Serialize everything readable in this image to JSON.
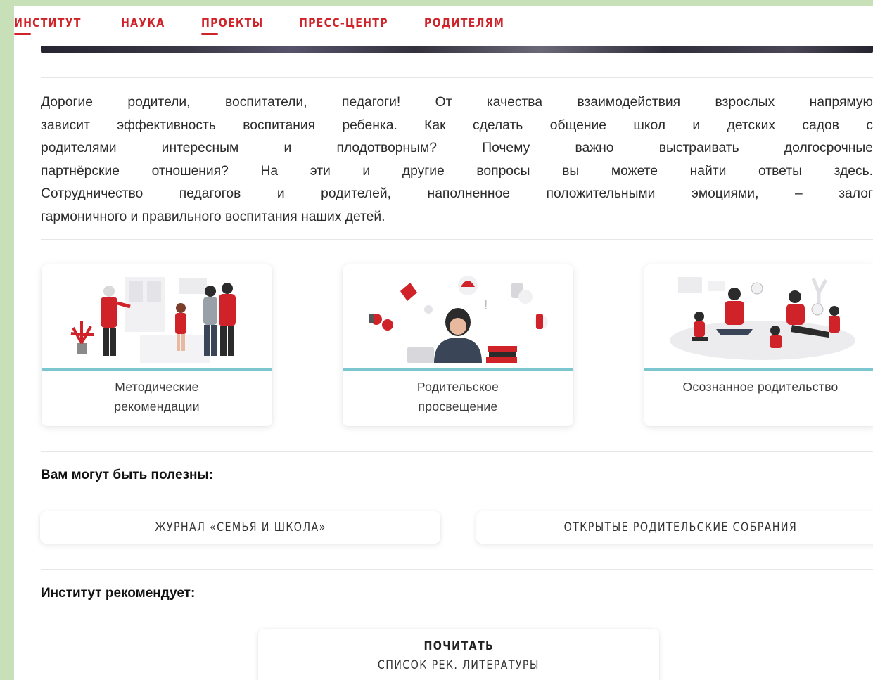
{
  "nav": {
    "items": [
      {
        "label": "ИНСТИТУТ",
        "active": true
      },
      {
        "label": "НАУКА",
        "active": false
      },
      {
        "label": "ПРОЕКТЫ",
        "active": true
      },
      {
        "label": "ПРЕСС-ЦЕНТР",
        "active": false
      },
      {
        "label": "РОДИТЕЛЯМ",
        "active": false
      }
    ]
  },
  "intro": {
    "lines": [
      "Дорогие родители, воспитатели, педагоги! От качества взаимодействия взрослых напрямую",
      "зависит эффективность воспитания ребенка. Как сделать общение школ и детских садов с",
      "родителями интересным и плодотворным? Почему важно выстраивать долгосрочные",
      "партнёрские отношения? На эти и другие вопросы вы можете найти ответы здесь.",
      "Сотрудничество педагогов и родителей, наполненное положительными эмоциями, – залог",
      "гармоничного и правильного воспитания наших детей."
    ]
  },
  "cards": [
    {
      "line1": "Методические",
      "line2": "рекомендации",
      "icon": "family-with-teacher-illustration"
    },
    {
      "line1": "Родительское",
      "line2": "просвещение",
      "icon": "thinking-parent-illustration"
    },
    {
      "line1": "Осознанное родительство",
      "line2": "",
      "icon": "family-playing-illustration"
    }
  ],
  "useful": {
    "title": "Вам могут быть полезны:",
    "buttons": [
      "ЖУРНАЛ «СЕМЬЯ И ШКОЛА»",
      "ОТКРЫТЫЕ РОДИТЕЛЬСКИЕ СОБРАНИЯ"
    ]
  },
  "recommends": {
    "title": "Институт рекомендует:",
    "button_line1": "ПОЧИТАТЬ",
    "button_line2": "СПИСОК РЕК. ЛИТЕРАТУРЫ"
  },
  "colors": {
    "accent": "#cf2229",
    "card_bar": "#7cc7cf"
  }
}
